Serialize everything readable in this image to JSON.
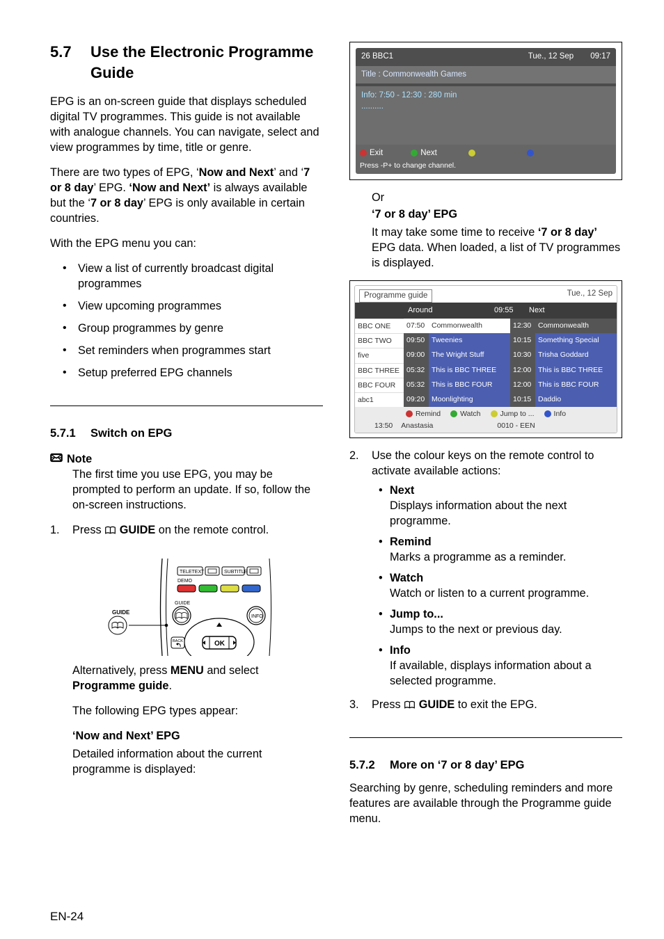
{
  "section": {
    "number": "5.7",
    "title": "Use the Electronic Programme Guide"
  },
  "left": {
    "intro": "EPG is an on-screen guide that displays scheduled digital TV programmes. This guide is not available with analogue channels. You can navigate, select and view programmes by time, title or genre.",
    "types_para": {
      "p1": "There are two types of EPG, ‘",
      "b1": "Now and Next",
      "p2": "’ and ‘",
      "b2": "7 or 8 day",
      "p3": "’ EPG. ",
      "b3": "‘Now and Next’",
      "p4": " is always available but the ‘",
      "b4": "7 or 8 day",
      "p5": "’ EPG is only available in certain countries."
    },
    "menu_line": "With the EPG menu you can:",
    "bullets": [
      "View a list of currently broadcast digital programmes",
      "View upcoming programmes",
      "Group programmes by genre",
      "Set reminders when programmes start",
      "Setup preferred EPG channels"
    ],
    "sub1": {
      "number": "5.7.1",
      "title": "Switch on EPG"
    },
    "note_label": "Note",
    "note_body": "The first time you use EPG, you may be prompted to perform an update. If so, follow the on-screen instructions.",
    "step1": {
      "n": "1.",
      "p1": "Press ",
      "b1": "GUIDE",
      "p2": " on the remote control."
    },
    "remote": {
      "guide_label": "GUIDE",
      "teletext": "TELETEXT",
      "subtitle": "SUBTITLE",
      "demo": "DEMO",
      "guide2": "GUIDE",
      "info": "INFO",
      "back": "BACK",
      "ok": "OK"
    },
    "alt": {
      "p1": "Alternatively, press ",
      "b1": "MENU",
      "p2": " and select ",
      "b2": "Programme guide",
      "p3": "."
    },
    "types_appear": "The following EPG types appear:",
    "now_next_h": "‘Now and Next’ EPG",
    "now_next_body": "Detailed information about the current programme is displayed:"
  },
  "right": {
    "osd1": {
      "channel": "26   BBC1",
      "date": "Tue., 12 Sep",
      "time": "09:17",
      "title_line": "Title : Commonwealth Games",
      "info_line": "Info: 7:50 - 12:30 : 280 min",
      "dots": "..........",
      "exit": "Exit",
      "next": "Next",
      "press": "Press -P+ to change channel."
    },
    "or": "Or",
    "seven_h": "‘7 or 8 day’ EPG",
    "seven_body": {
      "p1": "It may take some time to receive ",
      "b1": "‘7 or 8 day’",
      "p2": " EPG data. When loaded, a list of TV programmes is displayed."
    },
    "osd2": {
      "pg": "Programme guide",
      "date": "Tue., 12 Sep",
      "around": "Around",
      "around_t": "09:55",
      "next": "Next",
      "rows": [
        {
          "ch": "BBC ONE",
          "t1": "07:50",
          "n1": "Commonwealth",
          "t2": "12:30",
          "n2": "Commonwealth"
        },
        {
          "ch": "BBC TWO",
          "t1": "09:50",
          "n1": "Tweenies",
          "t2": "10:15",
          "n2": "Something Special"
        },
        {
          "ch": "five",
          "t1": "09:00",
          "n1": "The Wright Stuff",
          "t2": "10:30",
          "n2": "Trisha Goddard"
        },
        {
          "ch": "BBC THREE",
          "t1": "05:32",
          "n1": "This is BBC THREE",
          "t2": "12:00",
          "n2": "This is BBC THREE"
        },
        {
          "ch": "BBC FOUR",
          "t1": "05:32",
          "n1": "This is BBC FOUR",
          "t2": "12:00",
          "n2": "This is BBC FOUR"
        },
        {
          "ch": "abc1",
          "t1": "09:20",
          "n1": "Moonlighting",
          "t2": "10:15",
          "n2": "Daddio"
        }
      ],
      "remind": "Remind",
      "watch": "Watch",
      "jump": "Jump to ...",
      "info": "Info",
      "f_time": "13:50",
      "f_name": "Anastasia",
      "f_code": "0010 - EEN"
    },
    "step2": {
      "n": "2.",
      "text": "Use the colour keys on the remote control to activate available actions:"
    },
    "actions": [
      {
        "label": "Next",
        "desc": "Displays information about the next programme."
      },
      {
        "label": "Remind",
        "desc": "Marks a programme as a reminder."
      },
      {
        "label": "Watch",
        "desc": "Watch or listen to a current programme."
      },
      {
        "label": "Jump to...",
        "desc": "Jumps to the next or previous day."
      },
      {
        "label": "Info",
        "desc": "If available, displays information about a selected programme."
      }
    ],
    "step3": {
      "n": "3.",
      "p1": "Press ",
      "b1": "GUIDE",
      "p2": " to exit the EPG."
    },
    "sub2": {
      "number": "5.7.2",
      "title": "More on ‘7 or 8 day’ EPG"
    },
    "sub2_body": "Searching by genre, scheduling reminders and more features are available through the Programme guide menu."
  },
  "footer": "EN-24"
}
